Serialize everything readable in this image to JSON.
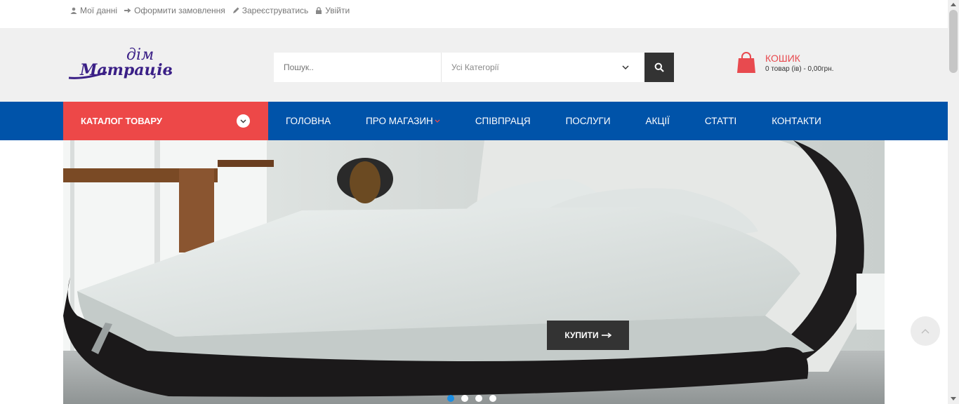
{
  "top_links": [
    {
      "label": "Мої данні",
      "icon": "user-icon"
    },
    {
      "label": "Оформити замовлення",
      "icon": "checkout-icon"
    },
    {
      "label": "Зареєструватись",
      "icon": "pencil-icon"
    },
    {
      "label": "Увійти",
      "icon": "lock-icon"
    }
  ],
  "logo": {
    "top": "дім",
    "main": "Матраців"
  },
  "search": {
    "placeholder": "Пошук..",
    "category": "Усі Категорії"
  },
  "cart": {
    "title": "КОШИК",
    "summary": "0 товар (ів) - 0,00грн."
  },
  "catalog_label": "КАТАЛОГ ТОВАРУ",
  "menu": [
    {
      "label": "ГОЛОВНА"
    },
    {
      "label": "ПРО МАГАЗИН",
      "has_dropdown": true
    },
    {
      "label": "СПІВПРАЦЯ"
    },
    {
      "label": "ПОСЛУГИ"
    },
    {
      "label": "АКЦІЇ"
    },
    {
      "label": "СТАТТІ"
    },
    {
      "label": "КОНТАКТИ"
    }
  ],
  "slider": {
    "button_label": "КУПИТИ",
    "slide_count": 4,
    "active_slide": 1
  },
  "colors": {
    "nav": "#0053a9",
    "catalog": "#ed4848",
    "accent_red": "#e84a4f",
    "dark": "#333333",
    "dot_active": "#1c8ee3"
  }
}
